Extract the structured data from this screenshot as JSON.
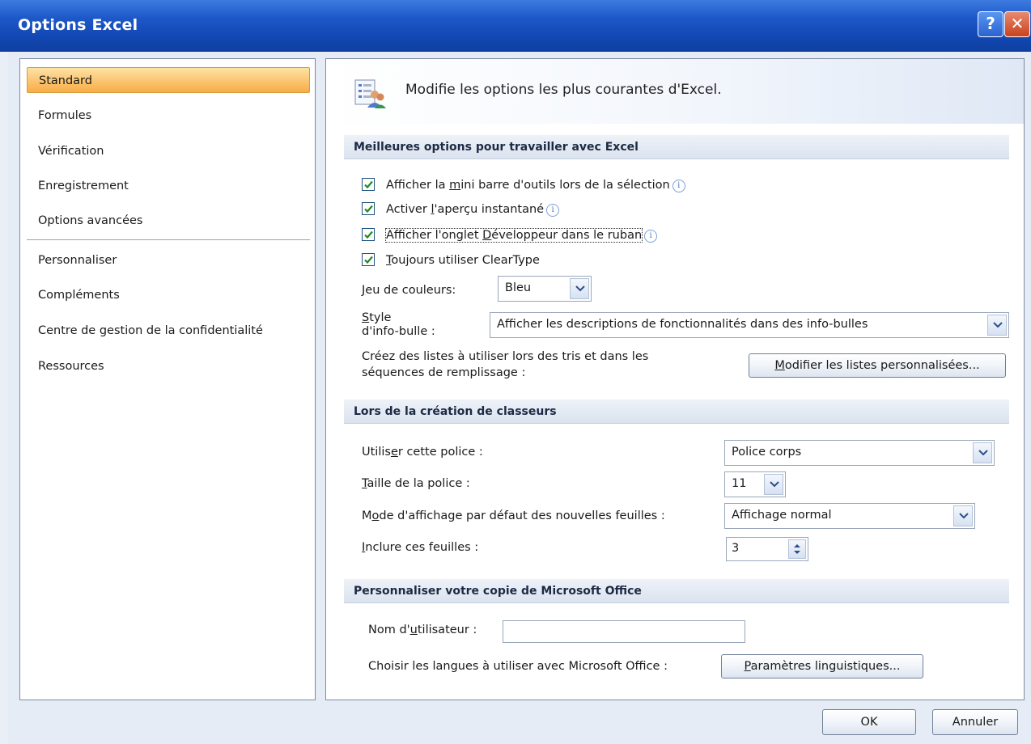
{
  "window": {
    "title": "Options Excel",
    "help_glyph": "?",
    "close_glyph": "✕"
  },
  "sidebar": {
    "items": [
      {
        "label": "Standard",
        "selected": true
      },
      {
        "label": "Formules"
      },
      {
        "label": "Vérification"
      },
      {
        "label": "Enregistrement"
      },
      {
        "label": "Options avancées"
      },
      {
        "label": "Personnaliser"
      },
      {
        "label": "Compléments"
      },
      {
        "label": "Centre de gestion de la confidentialité"
      },
      {
        "label": "Ressources"
      }
    ]
  },
  "header": {
    "text": "Modifie les options les plus courantes d'Excel."
  },
  "sections": {
    "best": {
      "title": "Meilleures options pour travailler avec Excel"
    },
    "create": {
      "title": "Lors de la création de classeurs"
    },
    "personalize": {
      "title": "Personnaliser votre copie de Microsoft Office"
    }
  },
  "checkboxes": {
    "mini_toolbar": {
      "pre": "Afficher la ",
      "key": "m",
      "post": "ini barre d'outils lors de la sélection",
      "checked": true
    },
    "live_preview": {
      "pre": "Activer ",
      "key": "l",
      "post": "'aperçu instantané",
      "checked": true
    },
    "developer_tab": {
      "pre": "Afficher l'onglet ",
      "key": "D",
      "post": "éveloppeur dans le ruban",
      "checked": true
    },
    "cleartype": {
      "pre": "",
      "key": "T",
      "post": "oujours utiliser ClearType",
      "checked": true
    }
  },
  "color_scheme": {
    "label_key": "J",
    "label_rest": "eu de couleurs:",
    "value": "Bleu"
  },
  "tooltip_style": {
    "label_key": "S",
    "label_line1_rest": "tyle",
    "label_line2": "d'info-bulle :",
    "value": "Afficher les descriptions de fonctionnalités dans des info-bulles"
  },
  "custom_lists": {
    "line1": "Créez des listes à utiliser lors des tris et dans les",
    "line2": "séquences de remplissage :",
    "button_key": "M",
    "button_rest": "odifier les listes personnalisées..."
  },
  "font": {
    "label_pre": "Utilis",
    "label_key": "e",
    "label_post": "r cette police :",
    "value": "Police corps"
  },
  "font_size": {
    "label_key": "T",
    "label_rest": "aille de la police :",
    "value": "11"
  },
  "view_mode": {
    "label_pre": "M",
    "label_key": "o",
    "label_post": "de d'affichage par défaut des nouvelles feuilles :",
    "value": "Affichage normal"
  },
  "sheets": {
    "label_key": "I",
    "label_rest": "nclure ces feuilles :",
    "value": "3"
  },
  "username": {
    "label_pre": "Nom d'",
    "label_key": "u",
    "label_post": "tilisateur :",
    "value": ""
  },
  "languages": {
    "label": "Choisir les langues à utiliser avec Microsoft Office :",
    "button_key": "P",
    "button_rest": "aramètres linguistiques..."
  },
  "footer": {
    "ok_label": "OK",
    "cancel_label": "Annuler"
  },
  "colors": {
    "title_bar": "#1248b4",
    "selection": "#fcc97a",
    "checkmark": "#1f8a1f"
  }
}
